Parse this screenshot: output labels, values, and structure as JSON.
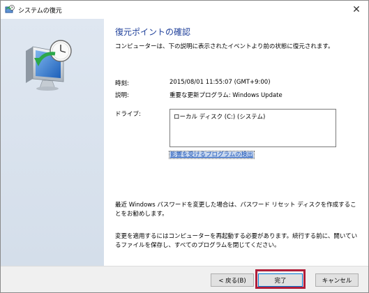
{
  "window": {
    "title": "システムの復元",
    "close_glyph": "✕"
  },
  "page": {
    "heading": "復元ポイントの確認",
    "intro": "コンピューターは、下の説明に表示されたイベントより前の状態に復元されます。"
  },
  "details": {
    "time_label": "時刻:",
    "time_value": "2015/08/01 11:55:07 (GMT+9:00)",
    "description_label": "説明:",
    "description_value": "重要な更新プログラム: Windows Update",
    "drive_label": "ドライブ:",
    "drive_value": "ローカル ディスク (C:) (システム)"
  },
  "links": {
    "affected_programs": "影響を受けるプログラムの検出"
  },
  "notes": {
    "password": "最近 Windows パスワードを変更した場合は、パスワード リセット ディスクを作成することをお勧めします。",
    "restart": "変更を適用するにはコンピューターを再起動する必要があります。続行する前に、開いているファイルを保存し、すべてのプログラムを閉じてください。"
  },
  "buttons": {
    "back": "< 戻る(B)",
    "finish": "完了",
    "cancel": "キャンセル"
  },
  "colors": {
    "heading": "#1e3f9a",
    "link": "#1e56b8",
    "highlight": "#b01e3a",
    "sidebar": "#dae3ee"
  },
  "icons": {
    "title": "system-restore-icon",
    "sidebar": "system-restore-monitor-clock-icon"
  }
}
